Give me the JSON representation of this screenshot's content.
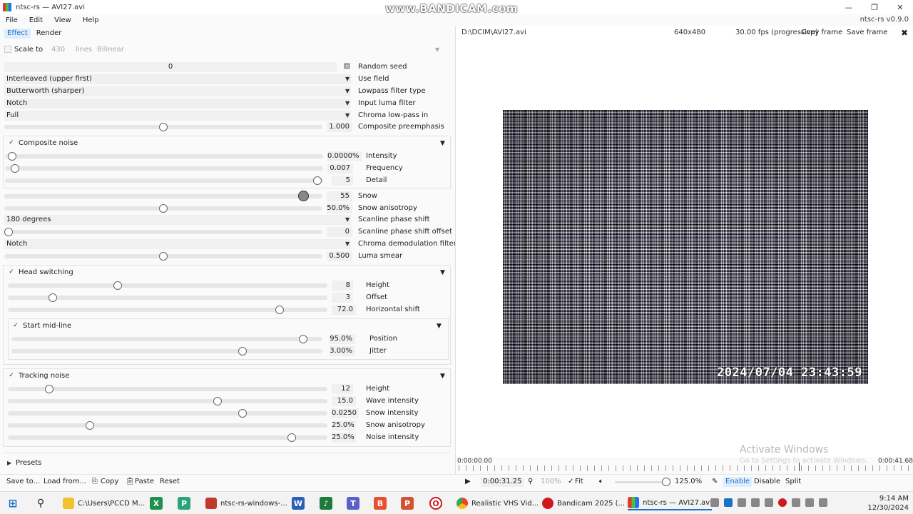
{
  "window": {
    "title": "ntsc-rs — AVI27.avi",
    "watermark": "www.BANDICAM.com",
    "min": "—",
    "max": "❐",
    "close": "✕"
  },
  "menu": {
    "file": "File",
    "edit": "Edit",
    "view": "View",
    "help": "Help",
    "version": "ntsc-rs v0.9.0"
  },
  "tabs": {
    "effect": "Effect",
    "render": "Render"
  },
  "scale": {
    "label": "Scale to",
    "value": "430",
    "unit": "lines",
    "filter": "Bilinear"
  },
  "settings": {
    "random_seed": {
      "value": "0",
      "label": "Random seed"
    },
    "use_field": {
      "value": "Interleaved (upper first)",
      "label": "Use field"
    },
    "lowpass_filter": {
      "value": "Butterworth (sharper)",
      "label": "Lowpass filter type"
    },
    "input_luma_filter": {
      "value": "Notch",
      "label": "Input luma filter"
    },
    "chroma_lowpass_in": {
      "value": "Full",
      "label": "Chroma low-pass in"
    },
    "composite_preemphasis": {
      "value": "1.000",
      "label": "Composite preemphasis",
      "level": 0.5
    }
  },
  "composite_noise": {
    "title": "Composite noise",
    "intensity": {
      "value": "0.0000%",
      "label": "Intensity",
      "level": 0.0
    },
    "frequency": {
      "value": "0.007",
      "label": "Frequency",
      "level": 0.01
    },
    "detail": {
      "value": "5",
      "label": "Detail",
      "level": 1.0
    }
  },
  "snow": {
    "value": "55",
    "label": "Snow",
    "level": 0.97
  },
  "snow_anisotropy": {
    "value": "50.0%",
    "label": "Snow anisotropy",
    "level": 0.5
  },
  "scanline_phase_shift": {
    "value": "180 degrees",
    "label": "Scanline phase shift"
  },
  "scanline_phase_shift_offset": {
    "value": "0",
    "label": "Scanline phase shift offset",
    "level": 0.0
  },
  "chroma_demod_filter": {
    "value": "Notch",
    "label": "Chroma demodulation filter"
  },
  "luma_smear": {
    "value": "0.500",
    "label": "Luma smear",
    "level": 0.5
  },
  "head_switching": {
    "title": "Head switching",
    "height": {
      "value": "8",
      "label": "Height",
      "level": 0.34
    },
    "offset": {
      "value": "3",
      "label": "Offset",
      "level": 0.13
    },
    "horizontal_shift": {
      "value": "72.0",
      "label": "Horizontal shift",
      "level": 0.86
    },
    "start_mid_line": {
      "title": "Start mid-line",
      "position": {
        "value": "95.0%",
        "label": "Position",
        "level": 0.95
      },
      "jitter": {
        "value": "3.00%",
        "label": "Jitter",
        "level": 0.75
      }
    }
  },
  "tracking_noise": {
    "title": "Tracking noise",
    "height": {
      "value": "12",
      "label": "Height",
      "level": 0.12
    },
    "wave_intensity": {
      "value": "15.0",
      "label": "Wave intensity",
      "level": 0.66
    },
    "snow_intensity": {
      "value": "0.0250",
      "label": "Snow intensity",
      "level": 0.74
    },
    "snow_anisotropy": {
      "value": "25.0%",
      "label": "Snow anisotropy",
      "level": 0.25
    },
    "noise_intensity": {
      "value": "25.0%",
      "label": "Noise intensity",
      "level": 0.9
    }
  },
  "presets": {
    "label": "Presets"
  },
  "bottom": {
    "save_to": "Save to...",
    "load_from": "Load from...",
    "copy": "Copy",
    "paste": "Paste",
    "reset": "Reset",
    "time": "0:00:31.25",
    "zoom": "100%",
    "fit": "Fit",
    "preview_scale": "125.0%",
    "enable": "Enable",
    "disable": "Disable",
    "split": "Split"
  },
  "preview": {
    "path": "D:\\DCIM\\AVI27.avi",
    "resolution": "640x480",
    "fps": "30.00 fps (progressive)",
    "copy_frame": "Copy frame",
    "save_frame": "Save frame",
    "close": "✖",
    "timestamp": "2024/07/04  23:43:59"
  },
  "timeline": {
    "start": "0:00:00.00",
    "end": "0:00:41.68"
  },
  "activation": {
    "title": "Activate Windows",
    "sub": "Go to Settings to activate Windows."
  },
  "taskbar": {
    "apps": [
      {
        "label": "C:\\Users\\PCCD M..."
      },
      {
        "label": "ntsc-rs-windows-..."
      },
      {
        "label": "Realistic VHS Vid..."
      },
      {
        "label": "Bandicam 2025 (..."
      },
      {
        "label": "ntsc-rs — AVI27.avi"
      }
    ],
    "time": "9:14 AM",
    "date": "12/30/2024"
  },
  "colors": {
    "accent": "#1a73c9",
    "accent_bg": "#dfeefc"
  }
}
